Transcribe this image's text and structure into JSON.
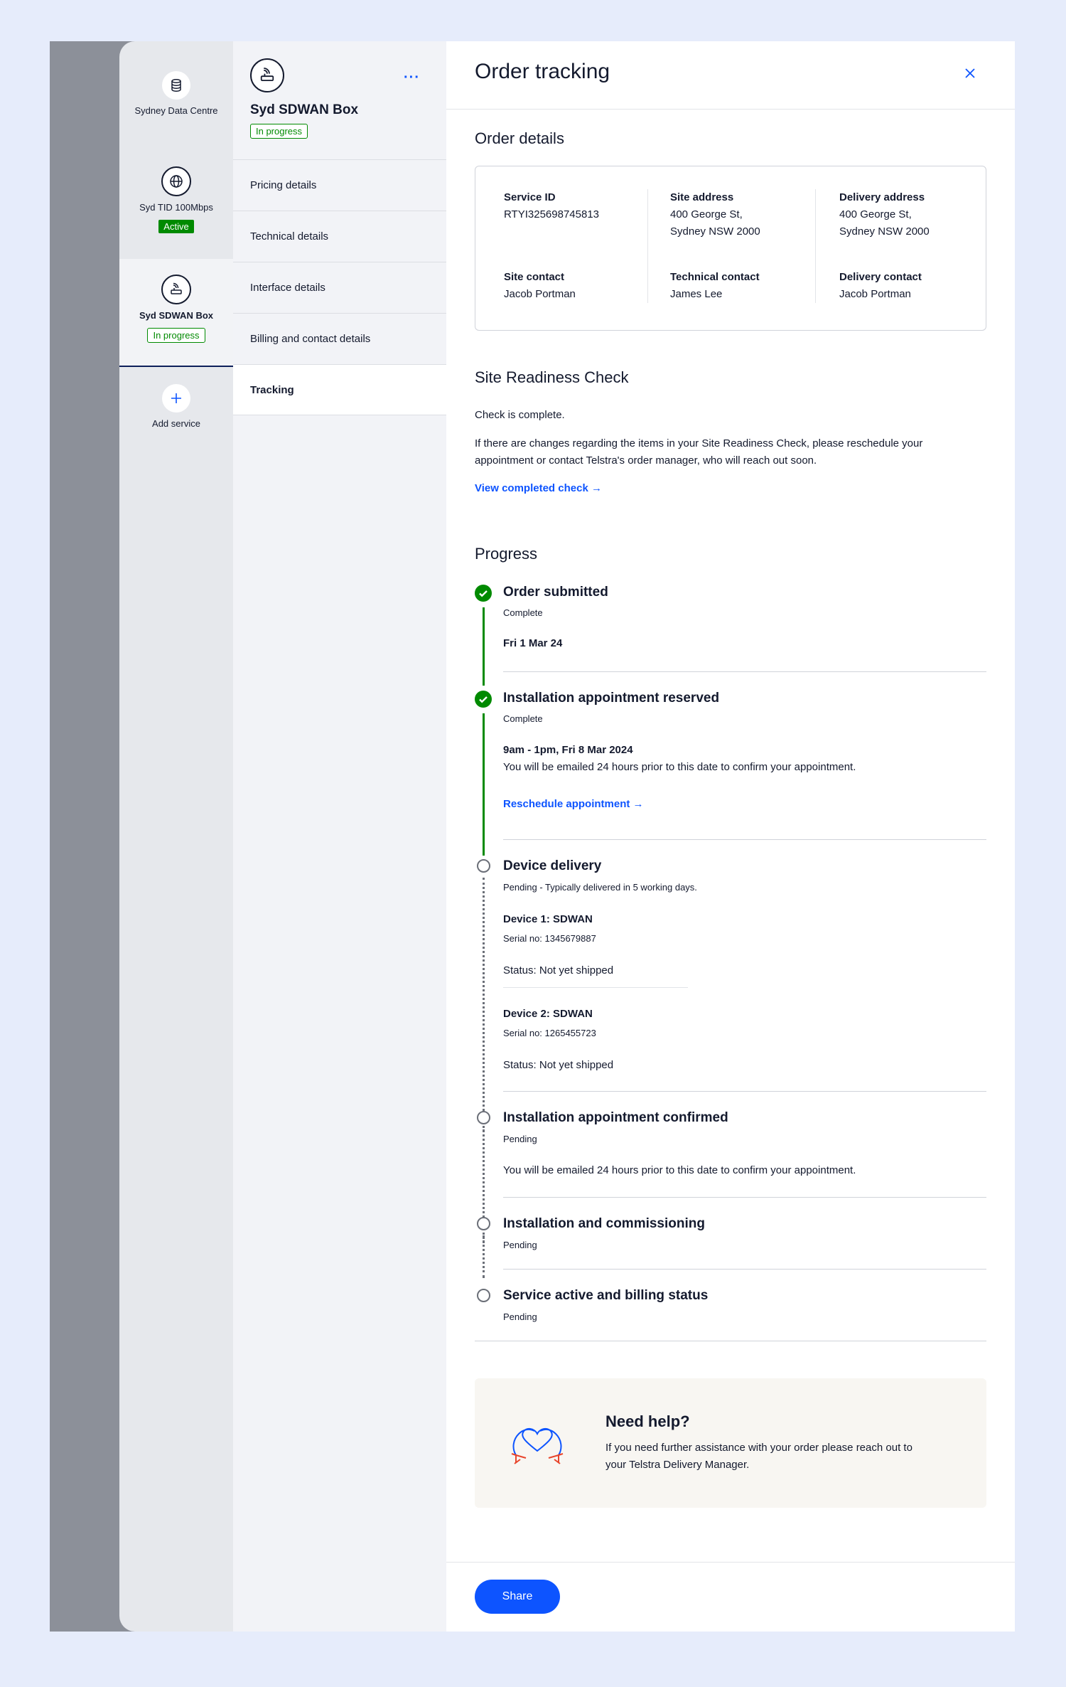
{
  "rail": {
    "items": [
      {
        "label": "Sydney Data Centre",
        "icon": "database-icon"
      },
      {
        "label": "Syd TID 100Mbps",
        "icon": "globe-icon",
        "status": "Active"
      },
      {
        "label": "Syd SDWAN Box",
        "icon": "router-icon",
        "status": "In progress"
      },
      {
        "label": "Add service",
        "icon": "plus-icon"
      }
    ]
  },
  "service": {
    "title": "Syd SDWAN Box",
    "status": "In progress",
    "more": "···",
    "menu": [
      "Pricing details",
      "Technical details",
      "Interface details",
      "Billing and contact details",
      "Tracking"
    ],
    "active_menu": "Tracking"
  },
  "panel": {
    "title": "Order tracking",
    "order_details": {
      "heading": "Order details",
      "service_id_label": "Service ID",
      "service_id": "RTYI325698745813",
      "site_address_label": "Site address",
      "site_address_1": "400 George St,",
      "site_address_2": "Sydney NSW 2000",
      "delivery_address_label": "Delivery address",
      "delivery_address_1": "400 George St,",
      "delivery_address_2": "Sydney NSW 2000",
      "site_contact_label": "Site contact",
      "site_contact": "Jacob Portman",
      "technical_contact_label": "Technical contact",
      "technical_contact": "James Lee",
      "delivery_contact_label": "Delivery contact",
      "delivery_contact": "Jacob Portman"
    },
    "readiness": {
      "heading": "Site Readiness Check",
      "status": "Check is complete.",
      "body": "If there are changes regarding the items in your Site Readiness Check, please reschedule your appointment or contact Telstra's order manager, who will reach out soon.",
      "link": "View completed check →"
    },
    "progress": {
      "heading": "Progress",
      "steps": [
        {
          "title": "Order submitted",
          "status": "Complete",
          "date": "Fri 1 Mar 24"
        },
        {
          "title": "Installation appointment reserved",
          "status": "Complete",
          "date": "9am - 1pm, Fri 8 Mar 2024",
          "note": "You will be emailed 24 hours prior to this date to confirm your appointment.",
          "link": "Reschedule appointment →"
        },
        {
          "title": "Device delivery",
          "status": "Pending - Typically delivered in 5 working days.",
          "devices": [
            {
              "name": "Device 1: SDWAN",
              "serial": "Serial no: 1345679887",
              "status": "Status: Not yet shipped"
            },
            {
              "name": "Device 2: SDWAN",
              "serial": "Serial no: 1265455723",
              "status": "Status: Not yet shipped"
            }
          ]
        },
        {
          "title": "Installation appointment confirmed",
          "status": "Pending",
          "note": "You will be emailed 24 hours prior to this date to confirm your appointment."
        },
        {
          "title": "Installation and commissioning",
          "status": "Pending"
        },
        {
          "title": "Service active and billing status",
          "status": "Pending"
        }
      ]
    },
    "help": {
      "title": "Need help?",
      "text": "If you need further assistance with your order please reach out to your Telstra Delivery Manager."
    },
    "share": "Share"
  },
  "colors": {
    "accent": "#0d54ff",
    "success": "#008a00",
    "help_bg": "#f8f6f2"
  }
}
